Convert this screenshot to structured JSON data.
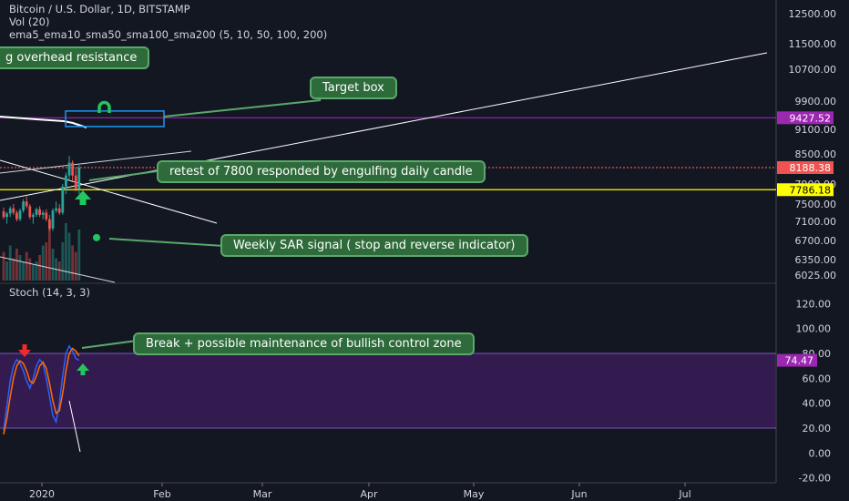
{
  "header": {
    "symbol": "Bitcoin / U.S. Dollar, 1D, BITSTAMP",
    "vol": "Vol (20)",
    "mas": "ema5_ema10_sma50_sma100_sma200 (5, 10, 50, 100, 200)",
    "stoch": "Stoch (14, 3, 3)"
  },
  "annotations": {
    "overhead": "g overhead  resistance",
    "target": "Target box",
    "retest": "retest of 7800 responded by engulfing daily candle",
    "sar": "Weekly SAR signal ( stop and reverse indicator)",
    "breakzone": "Break + possible maintenance of bullish control zone"
  },
  "colors": {
    "background": "#131722",
    "callout_fill": "#2e6b3a",
    "callout_border": "#5aa86b",
    "purple_line": "#9c27b0",
    "red_line": "#ef5350",
    "yellow_line": "#ffff00",
    "box_border": "#2196f3",
    "arrow_green": "#22c55e",
    "arrow_red": "#ef2b2b",
    "stoch_k": "#2962ff",
    "stoch_d": "#ff6d00",
    "stoch_zone": "#4a1d6e"
  },
  "chart_data": [
    {
      "type": "candlestick",
      "title": "Bitcoin / U.S. Dollar, 1D, BITSTAMP",
      "price_axis_ticks": [
        "12500.00",
        "11500.00",
        "10700.00",
        "9900.00",
        "9100.00",
        "8500.00",
        "7900.00",
        "7500.00",
        "7100.00",
        "6700.00",
        "6350.00",
        "6025.00"
      ],
      "price_labels": [
        {
          "text": "9427.52",
          "value": 9427.52,
          "color": "#9c27b0"
        },
        {
          "text": "8188.38",
          "value": 8188.38,
          "color": "#ef5350"
        },
        {
          "text": "7786.18",
          "value": 7786.18,
          "color": "#ffff00"
        }
      ],
      "horizontal_levels": [
        {
          "value": 9427.52,
          "color": "#9c27b0",
          "style": "solid"
        },
        {
          "value": 8188.38,
          "color": "#ef5350",
          "style": "dotted"
        },
        {
          "value": 7786.18,
          "color": "#ffff00",
          "style": "solid"
        }
      ],
      "time_axis_labels": [
        "2020",
        "Feb",
        "Mar",
        "Apr",
        "May",
        "Jun",
        "Jul"
      ],
      "candles": [
        {
          "o": 7330,
          "h": 7420,
          "l": 7150,
          "c": 7200
        },
        {
          "o": 7200,
          "h": 7320,
          "l": 7050,
          "c": 7280
        },
        {
          "o": 7280,
          "h": 7450,
          "l": 7200,
          "c": 7400
        },
        {
          "o": 7400,
          "h": 7500,
          "l": 7250,
          "c": 7300
        },
        {
          "o": 7300,
          "h": 7350,
          "l": 7100,
          "c": 7150
        },
        {
          "o": 7150,
          "h": 7400,
          "l": 7100,
          "c": 7350
        },
        {
          "o": 7350,
          "h": 7600,
          "l": 7300,
          "c": 7550
        },
        {
          "o": 7550,
          "h": 7650,
          "l": 7400,
          "c": 7450
        },
        {
          "o": 7450,
          "h": 7500,
          "l": 7150,
          "c": 7200
        },
        {
          "o": 7200,
          "h": 7300,
          "l": 7050,
          "c": 7250
        },
        {
          "o": 7250,
          "h": 7420,
          "l": 7200,
          "c": 7380
        },
        {
          "o": 7380,
          "h": 7450,
          "l": 7200,
          "c": 7250
        },
        {
          "o": 7250,
          "h": 7350,
          "l": 7150,
          "c": 7300
        },
        {
          "o": 7300,
          "h": 7380,
          "l": 7100,
          "c": 7150
        },
        {
          "o": 7150,
          "h": 7250,
          "l": 6900,
          "c": 6950
        },
        {
          "o": 6950,
          "h": 7400,
          "l": 6900,
          "c": 7350
        },
        {
          "o": 7350,
          "h": 7550,
          "l": 7300,
          "c": 7400
        },
        {
          "o": 7400,
          "h": 7500,
          "l": 7250,
          "c": 7300
        },
        {
          "o": 7300,
          "h": 7900,
          "l": 7250,
          "c": 7850
        },
        {
          "o": 7850,
          "h": 8100,
          "l": 7700,
          "c": 8050
        },
        {
          "o": 8050,
          "h": 8450,
          "l": 7950,
          "c": 8300
        },
        {
          "o": 8300,
          "h": 8350,
          "l": 7950,
          "c": 8050
        },
        {
          "o": 8050,
          "h": 8200,
          "l": 7750,
          "c": 7800
        },
        {
          "o": 7800,
          "h": 8250,
          "l": 7700,
          "c": 8190
        }
      ],
      "volume_bars": [
        0.45,
        0.3,
        0.55,
        0.35,
        0.5,
        0.4,
        0.3,
        0.45,
        0.35,
        0.25,
        0.3,
        0.4,
        0.55,
        0.6,
        0.85,
        0.5,
        0.35,
        0.3,
        0.6,
        0.9,
        0.75,
        0.55,
        0.45,
        0.8
      ],
      "sar_dot": 6760,
      "target_box": {
        "from": 9180,
        "to": 9620
      }
    },
    {
      "type": "line",
      "title": "Stoch (14, 3, 3)",
      "axis_ticks": [
        "120.00",
        "100.00",
        "80.00",
        "60.00",
        "40.00",
        "20.00",
        "0.00",
        "-20.00"
      ],
      "ylim": [
        -25,
        130
      ],
      "zone": [
        20,
        80
      ],
      "last_value_label": "74.47",
      "series": [
        {
          "values": [
            18,
            38,
            58,
            70,
            75,
            72,
            66,
            58,
            52,
            60,
            70,
            75,
            72,
            60,
            45,
            30,
            25,
            40,
            62,
            80,
            86,
            82,
            76,
            74.5
          ]
        },
        {
          "values": [
            15,
            28,
            45,
            60,
            70,
            74,
            72,
            66,
            58,
            56,
            62,
            70,
            73,
            68,
            56,
            42,
            32,
            34,
            48,
            66,
            80,
            84,
            82,
            78
          ]
        }
      ]
    }
  ]
}
